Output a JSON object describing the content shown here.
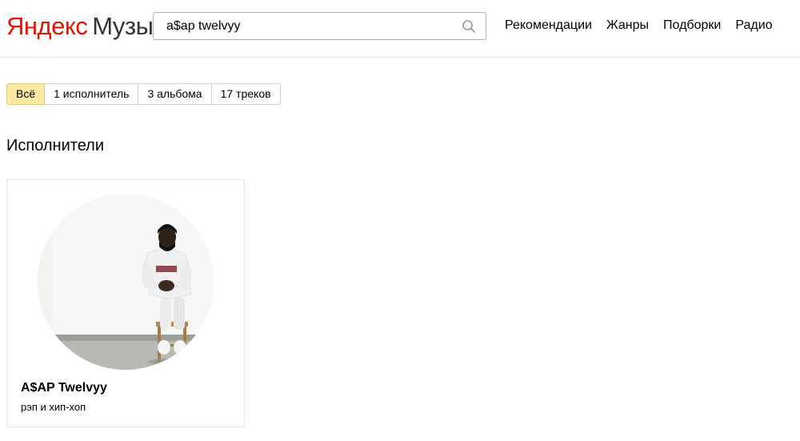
{
  "header": {
    "logo": {
      "brand": "Яндекс",
      "product": "Музыка"
    },
    "search": {
      "value": "a$ap twelvyy",
      "icon": "search-icon"
    },
    "nav": [
      {
        "label": "Рекомендации"
      },
      {
        "label": "Жанры"
      },
      {
        "label": "Подборки"
      },
      {
        "label": "Радио"
      }
    ]
  },
  "filters": [
    {
      "label": "Всё",
      "active": true
    },
    {
      "label": "1 исполнитель",
      "active": false
    },
    {
      "label": "3 альбома",
      "active": false
    },
    {
      "label": "17 треков",
      "active": false
    }
  ],
  "section": {
    "title": "Исполнители"
  },
  "artists": [
    {
      "name": "A$AP Twelvyy",
      "genre": "рэп и хип-хоп"
    }
  ],
  "colors": {
    "brand_red": "#e61400",
    "active_filter_bg": "#fde9a5"
  }
}
